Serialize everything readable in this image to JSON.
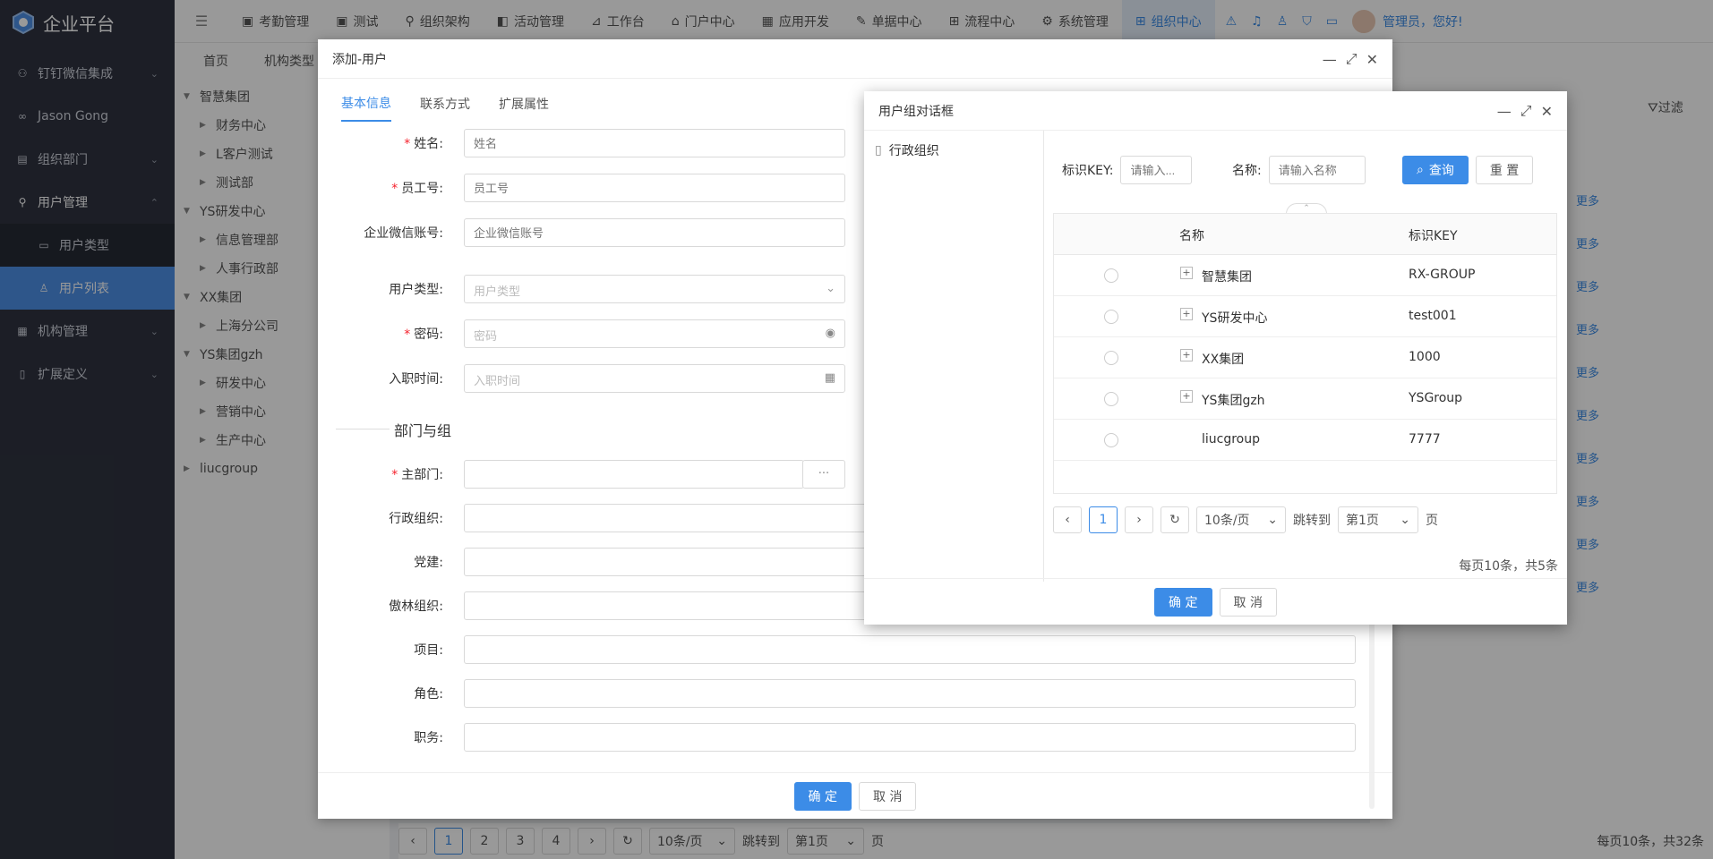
{
  "app": {
    "title": "企业平台"
  },
  "sidebar": {
    "items": [
      {
        "label": "钉钉微信集成"
      },
      {
        "label": "Jason Gong"
      },
      {
        "label": "组织部门"
      },
      {
        "label": "用户管理"
      },
      {
        "label": "用户类型"
      },
      {
        "label": "用户列表"
      },
      {
        "label": "机构管理"
      },
      {
        "label": "扩展定义"
      }
    ]
  },
  "topnav": {
    "items": [
      {
        "label": "考勤管理"
      },
      {
        "label": "测试"
      },
      {
        "label": "组织架构"
      },
      {
        "label": "活动管理"
      },
      {
        "label": "工作台"
      },
      {
        "label": "门户中心"
      },
      {
        "label": "应用开发"
      },
      {
        "label": "单据中心"
      },
      {
        "label": "流程中心"
      },
      {
        "label": "系统管理"
      },
      {
        "label": "组织中心"
      }
    ],
    "user_greeting": "管理员，您好!"
  },
  "tabs": {
    "home": "首页",
    "org_type": "机构类型"
  },
  "tree": {
    "nodes": [
      {
        "label": "智慧集团"
      },
      {
        "label": "财务中心"
      },
      {
        "label": "L客户测试"
      },
      {
        "label": "测试部"
      },
      {
        "label": "YS研发中心"
      },
      {
        "label": "信息管理部"
      },
      {
        "label": "人事行政部"
      },
      {
        "label": "XX集团"
      },
      {
        "label": "上海分公司"
      },
      {
        "label": "YS集团gzh"
      },
      {
        "label": "研发中心"
      },
      {
        "label": "营销中心"
      },
      {
        "label": "生产中心"
      },
      {
        "label": "liucgroup"
      }
    ]
  },
  "list": {
    "filter": "过滤",
    "more": "更多"
  },
  "pager": {
    "pages": [
      "1",
      "2",
      "3",
      "4"
    ],
    "size": "10条/页",
    "jump": "跳转到",
    "page_sel": "第1页",
    "page_unit": "页",
    "total": "每页10条，共32条"
  },
  "dialog_add": {
    "title": "添加-用户",
    "tabs": [
      "基本信息",
      "联系方式",
      "扩展属性"
    ],
    "fields": {
      "name": {
        "label": "姓名",
        "placeholder": "姓名"
      },
      "emp_no": {
        "label": "员工号",
        "placeholder": "员工号"
      },
      "wechat": {
        "label": "企业微信账号",
        "placeholder": "企业微信账号"
      },
      "user_type": {
        "label": "用户类型",
        "placeholder": "用户类型"
      },
      "password": {
        "label": "密码",
        "placeholder": "密码"
      },
      "join_date": {
        "label": "入职时间",
        "placeholder": "入职时间"
      },
      "main_dept": {
        "label": "主部门"
      },
      "admin_org": {
        "label": "行政组织"
      },
      "party": {
        "label": "党建"
      },
      "aolin_org": {
        "label": "傲林组织"
      },
      "project": {
        "label": "项目"
      },
      "role": {
        "label": "角色"
      },
      "position": {
        "label": "职务"
      }
    },
    "section": "部门与组",
    "ok": "确 定",
    "cancel": "取 消"
  },
  "dialog_group": {
    "title": "用户组对话框",
    "left_tree": "行政组织",
    "search": {
      "key_label": "标识KEY:",
      "key_placeholder": "请输入...",
      "name_label": "名称:",
      "name_placeholder": "请输入名称",
      "query": "查询",
      "reset": "重 置"
    },
    "columns": [
      "名称",
      "标识KEY"
    ],
    "rows": [
      {
        "name": "智慧集团",
        "key": "RX-GROUP"
      },
      {
        "name": "YS研发中心",
        "key": "test001"
      },
      {
        "name": "XX集团",
        "key": "1000"
      },
      {
        "name": "YS集团gzh",
        "key": "YSGroup"
      },
      {
        "name": "liucgroup",
        "key": "7777"
      }
    ],
    "pager": {
      "page": "1",
      "size": "10条/页",
      "jump": "跳转到",
      "page_sel": "第1页",
      "page_unit": "页",
      "total": "每页10条，共5条"
    },
    "ok": "确 定",
    "cancel": "取 消"
  }
}
